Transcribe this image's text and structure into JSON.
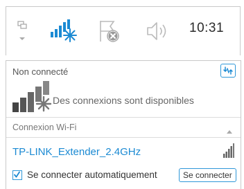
{
  "taskbar": {
    "icons": [
      "network-monitor-icon",
      "wifi-signal-starburst-icon",
      "flag-action-center-icon",
      "speaker-volume-icon"
    ],
    "clock": "10:31",
    "accent": "#2e97d8"
  },
  "panel": {
    "status_label": "Non connecté",
    "refresh_icon": "refresh-icon",
    "available_text": "Des connexions sont disponibles",
    "section_label": "Connexion Wi-Fi",
    "network": {
      "name": "TP-LINK_Extender_2.4GHz",
      "signal_icon": "signal-strength-icon"
    },
    "auto_connect_label": "Se connecter automatiquement",
    "auto_connect_checked": true,
    "connect_button": "Se connecter"
  },
  "colors": {
    "link_blue": "#1b8ad3",
    "border": "#c9c9c9"
  }
}
